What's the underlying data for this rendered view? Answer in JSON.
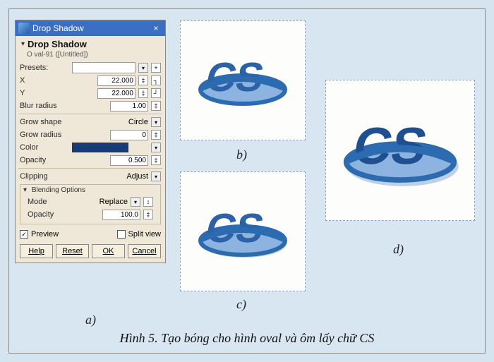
{
  "titlebar": {
    "title": "Drop Shadow",
    "close": "×"
  },
  "header": {
    "title": "Drop Shadow",
    "sub": "O val-91 ([Untitled])"
  },
  "presets_label": "Presets:",
  "x_label": "X",
  "y_label": "Y",
  "x_val": "22.000",
  "y_val": "22.000",
  "blur_label": "Blur radius",
  "blur_val": "1.00",
  "grow_shape_label": "Grow shape",
  "grow_shape_val": "Circle",
  "grow_radius_label": "Grow radius",
  "grow_radius_val": "0",
  "color_label": "Color",
  "opacity_label": "Opacity",
  "opacity_val": "0.500",
  "clipping_label": "Clipping",
  "clipping_val": "Adjust",
  "blend_title": "Blending Options",
  "mode_label": "Mode",
  "mode_val": "Replace",
  "bopacity_label": "Opacity",
  "bopacity_val": "100.0",
  "preview_label": "Preview",
  "split_label": "Split view",
  "btn_help": "Help",
  "btn_reset": "Reset",
  "btn_ok": "OK",
  "btn_cancel": "Cancel",
  "labels": {
    "a": "a)",
    "b": "b)",
    "c": "c)",
    "d": "d)"
  },
  "caption": "Hình 5. Tạo bóng cho hình oval và ôm lấy chữ CS"
}
